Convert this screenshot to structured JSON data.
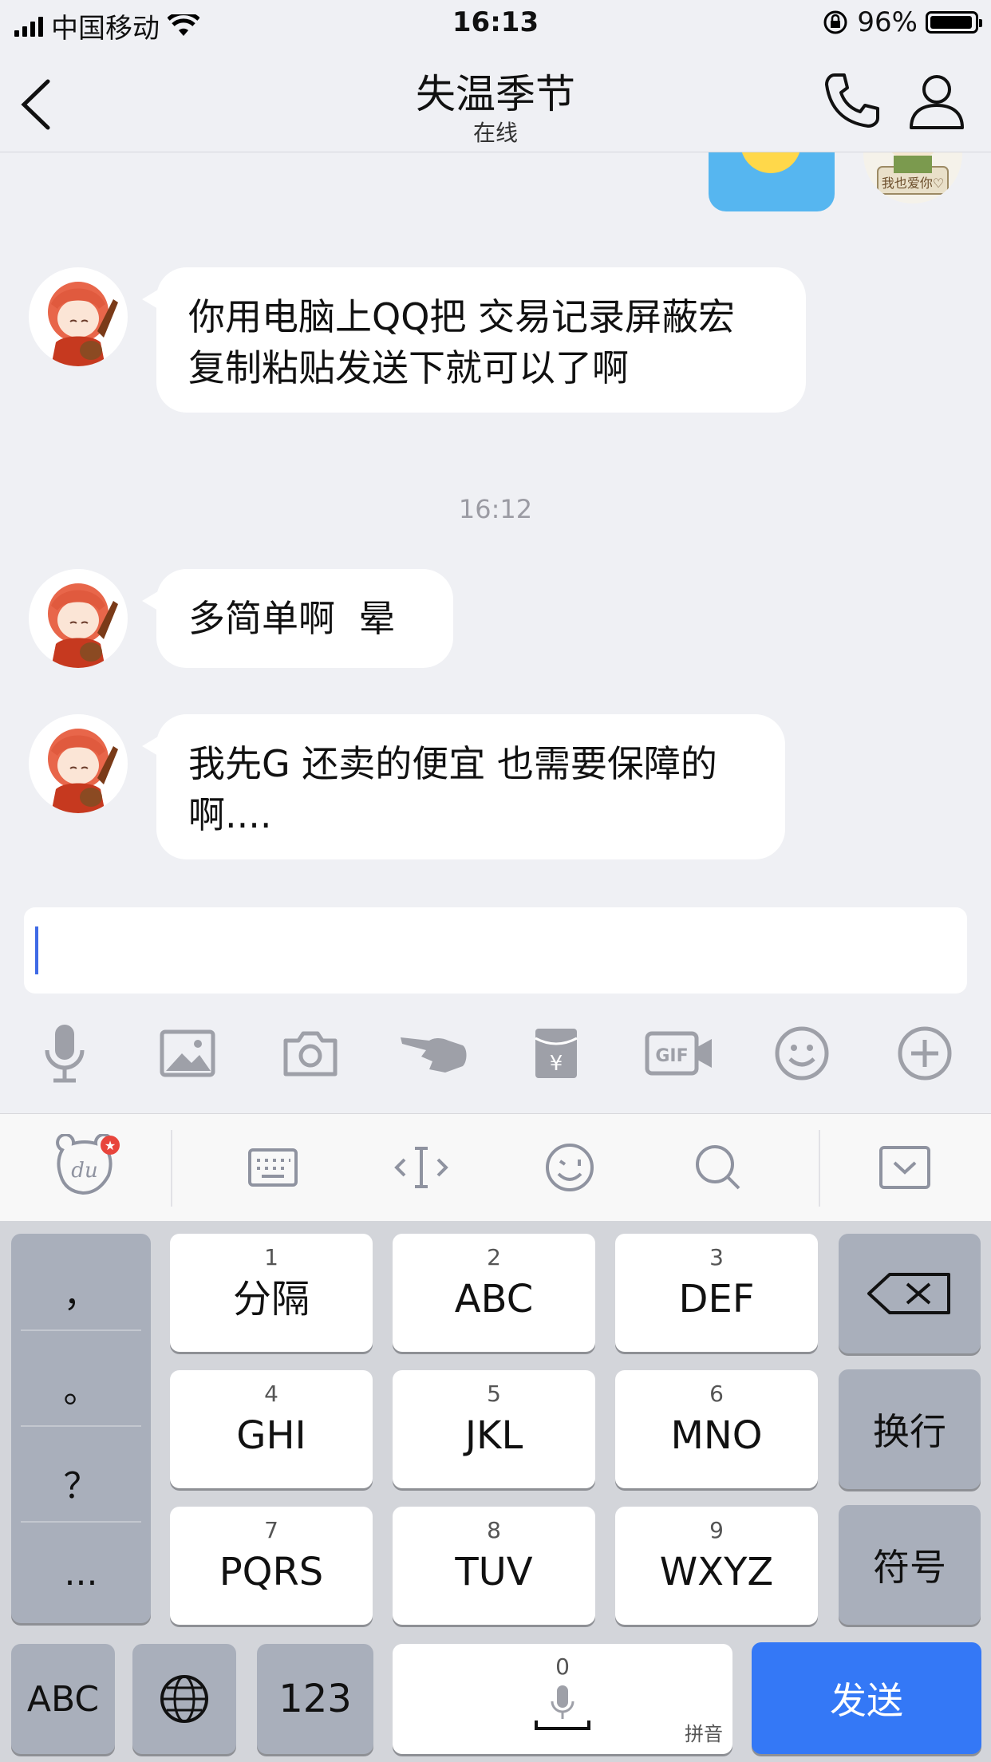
{
  "status_bar": {
    "carrier": "中国移动",
    "time": "16:13",
    "battery_percent": "96%",
    "battery_level": 0.96
  },
  "nav": {
    "title": "失温季节",
    "subtitle": "在线"
  },
  "stickers": {
    "my_avatar_caption": "我也爱你♡"
  },
  "messages": [
    {
      "text": "你用电脑上QQ把 交易记录屏蔽宏 复制粘贴发送下就可以了啊"
    },
    {
      "text": "多简单啊  晕"
    },
    {
      "text": "我先G 还卖的便宜 也需要保障的啊...."
    }
  ],
  "timestamp": "16:12",
  "toolbar_icons": [
    "mic-icon",
    "image-icon",
    "camera-icon",
    "poke-icon",
    "red-envelope-icon",
    "gif-icon",
    "emoji-icon",
    "plus-icon"
  ],
  "keyboard_top_icons": [
    "du-logo-icon",
    "keyboard-icon",
    "cursor-icon",
    "emoji-wink-icon",
    "search-icon",
    "collapse-icon"
  ],
  "keyboard": {
    "punctuation": [
      "，",
      "。",
      "？",
      "..."
    ],
    "keys": [
      {
        "num": "1",
        "label": "分隔"
      },
      {
        "num": "2",
        "label": "ABC"
      },
      {
        "num": "3",
        "label": "DEF"
      },
      {
        "num": "4",
        "label": "GHI"
      },
      {
        "num": "5",
        "label": "JKL"
      },
      {
        "num": "6",
        "label": "MNO"
      },
      {
        "num": "7",
        "label": "PQRS"
      },
      {
        "num": "8",
        "label": "TUV"
      },
      {
        "num": "9",
        "label": "WXYZ"
      }
    ],
    "newline": "换行",
    "symbols": "符号",
    "abc": "ABC",
    "num123": "123",
    "space_num": "0",
    "space_hint": "拼音",
    "send": "发送"
  },
  "colors": {
    "accent": "#3478f6",
    "background": "#eff0f4"
  }
}
